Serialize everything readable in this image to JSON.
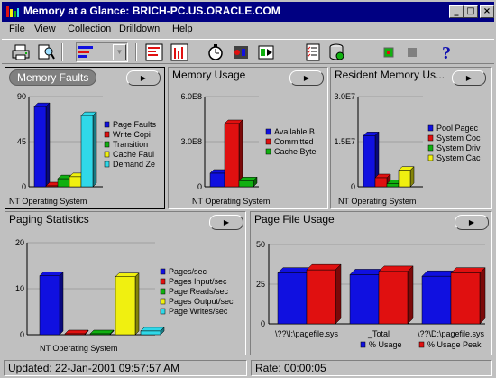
{
  "window": {
    "title": "Memory at a Glance: BRICH-PC.US.ORACLE.COM"
  },
  "menu": [
    "File",
    "View",
    "Collection",
    "Drilldown",
    "Help"
  ],
  "toolbar": {
    "icons": [
      "print-icon",
      "print-preview-icon",
      "chart-type-icon",
      "chart-style-combo",
      "bar-chart-icon",
      "column-chart-icon",
      "stopwatch-icon",
      "traffic-light-icon",
      "play-record-icon",
      "checklist-icon",
      "database-icon",
      "record-icon",
      "stop-icon",
      "help-icon"
    ]
  },
  "panels": {
    "memory_faults": {
      "title": "Memory Faults"
    },
    "memory_usage": {
      "title": "Memory Usage"
    },
    "resident_memory": {
      "title": "Resident Memory Us..."
    },
    "paging_statistics": {
      "title": "Paging Statistics"
    },
    "page_file_usage": {
      "title": "Page File Usage"
    }
  },
  "colors": {
    "blue": "#1010e0",
    "red": "#e01010",
    "green": "#10b010",
    "yellow": "#f0f010",
    "cyan": "#30d8e8"
  },
  "chart_data": [
    {
      "type": "bar",
      "panel": "memory_faults",
      "categories": [
        "NT Operating System"
      ],
      "series": [
        {
          "name": "Page Faults",
          "values": [
            80
          ]
        },
        {
          "name": "Write Copi",
          "values": [
            0
          ]
        },
        {
          "name": "Transition",
          "values": [
            8
          ]
        },
        {
          "name": "Cache Faul",
          "values": [
            10
          ]
        },
        {
          "name": "Demand Ze",
          "values": [
            71
          ]
        }
      ],
      "yticks": [
        "0",
        "45",
        "90"
      ],
      "ylim": [
        0,
        90
      ]
    },
    {
      "type": "bar",
      "panel": "memory_usage",
      "categories": [
        "NT Operating System"
      ],
      "series": [
        {
          "name": "Available B",
          "values": [
            90000000
          ]
        },
        {
          "name": "Committed",
          "values": [
            420000000
          ]
        },
        {
          "name": "Cache Byte",
          "values": [
            40000000
          ]
        }
      ],
      "yticks": [
        "0",
        "3.0E8",
        "6.0E8"
      ],
      "ylim": [
        0,
        600000000
      ]
    },
    {
      "type": "bar",
      "panel": "resident_memory",
      "categories": [
        "NT Operating System"
      ],
      "series": [
        {
          "name": "Pool Pagec",
          "values": [
            17000000
          ]
        },
        {
          "name": "System Coc",
          "values": [
            3000000
          ]
        },
        {
          "name": "System Driv",
          "values": [
            1000000
          ]
        },
        {
          "name": "System Cac",
          "values": [
            5500000
          ]
        }
      ],
      "yticks": [
        "0",
        "1.5E7",
        "3.0E7"
      ],
      "ylim": [
        0,
        30000000
      ]
    },
    {
      "type": "bar",
      "panel": "paging_statistics",
      "categories": [
        "NT Operating System"
      ],
      "series": [
        {
          "name": "Pages/sec",
          "values": [
            12.8
          ]
        },
        {
          "name": "Pages Input/sec",
          "values": [
            0
          ]
        },
        {
          "name": "Page Reads/sec",
          "values": [
            0
          ]
        },
        {
          "name": "Pages Output/sec",
          "values": [
            12.6
          ]
        },
        {
          "name": "Page Writes/sec",
          "values": [
            0.8
          ]
        }
      ],
      "yticks": [
        "0",
        "10",
        "20"
      ],
      "ylim": [
        0,
        20
      ]
    },
    {
      "type": "bar",
      "panel": "page_file_usage",
      "categories": [
        "\\??\\I:\\pagefile.sys",
        "_Total",
        "\\??\\D:\\pagefile.sys"
      ],
      "series": [
        {
          "name": "% Usage",
          "values": [
            32,
            31,
            30
          ]
        },
        {
          "name": "% Usage Peak",
          "values": [
            34,
            33,
            32
          ]
        }
      ],
      "yticks": [
        "0",
        "25",
        "50"
      ],
      "ylim": [
        0,
        50
      ]
    }
  ],
  "status": {
    "updated": "Updated: 22-Jan-2001 09:57:57 AM",
    "rate": "Rate: 00:00:05"
  }
}
